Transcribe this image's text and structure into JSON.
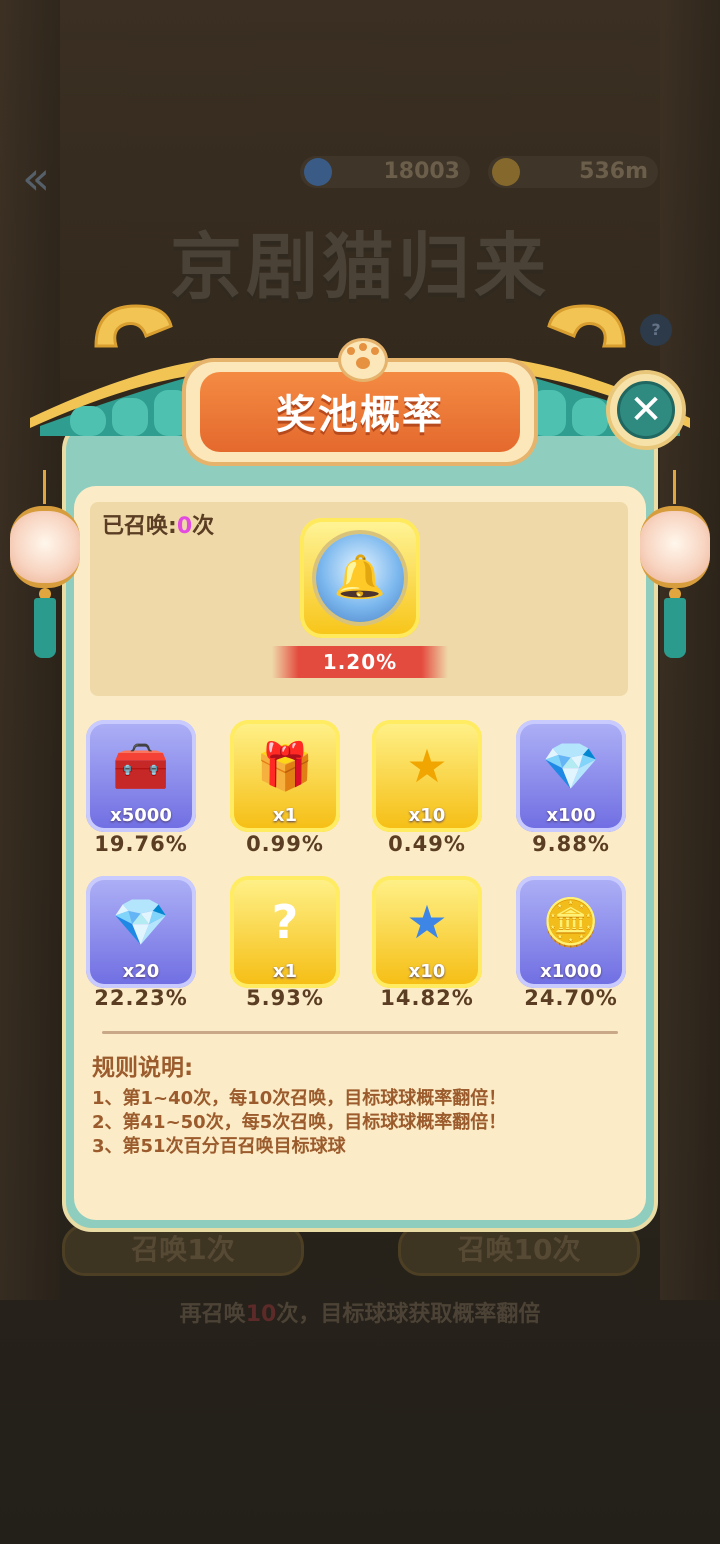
{
  "background": {
    "gem_balance": "18003",
    "coin_balance": "536m",
    "title": "京剧猫归来",
    "summon_once": "召唤1次",
    "summon_ten": "召唤10次",
    "tip_prefix": "再召唤",
    "tip_count": "10",
    "tip_suffix": "次，目标球球获取概率翻倍"
  },
  "modal": {
    "title": "奖池概率",
    "summoned_label": "已召唤:",
    "summoned_count": "0",
    "summoned_unit": "次",
    "target": {
      "icon": "blue-bell-orb-icon",
      "rate": "1.20%"
    },
    "rewards": [
      {
        "icon": "treasure-chest-coins-icon",
        "qty": "x5000",
        "rate": "19.76%",
        "style": "purple"
      },
      {
        "icon": "golden-chest-icon",
        "qty": "x1",
        "rate": "0.99%",
        "style": "gold"
      },
      {
        "icon": "gold-star-icon",
        "qty": "x10",
        "rate": "0.49%",
        "style": "gold"
      },
      {
        "icon": "blue-gems-icon",
        "qty": "x100",
        "rate": "9.88%",
        "style": "purple"
      },
      {
        "icon": "blue-gems-icon",
        "qty": "x20",
        "rate": "22.23%",
        "style": "purple"
      },
      {
        "icon": "mystery-orb-icon",
        "qty": "x1",
        "rate": "5.93%",
        "style": "gold"
      },
      {
        "icon": "blue-star-icon",
        "qty": "x10",
        "rate": "14.82%",
        "style": "gold"
      },
      {
        "icon": "gold-coins-icon",
        "qty": "x1000",
        "rate": "24.70%",
        "style": "purple"
      }
    ],
    "rules_title": "规则说明:",
    "rules": [
      "1、第1~40次，每10次召唤，目标球球概率翻倍！",
      "2、第41~50次，每5次召唤，目标球球概率翻倍！",
      "3、第51次百分百召唤目标球球"
    ]
  },
  "colors": {
    "panel_teal": "#8fcdbe",
    "title_orange": "#f48b43",
    "rate_red": "#e44b3f",
    "rules_brown": "#9b5b2c"
  }
}
